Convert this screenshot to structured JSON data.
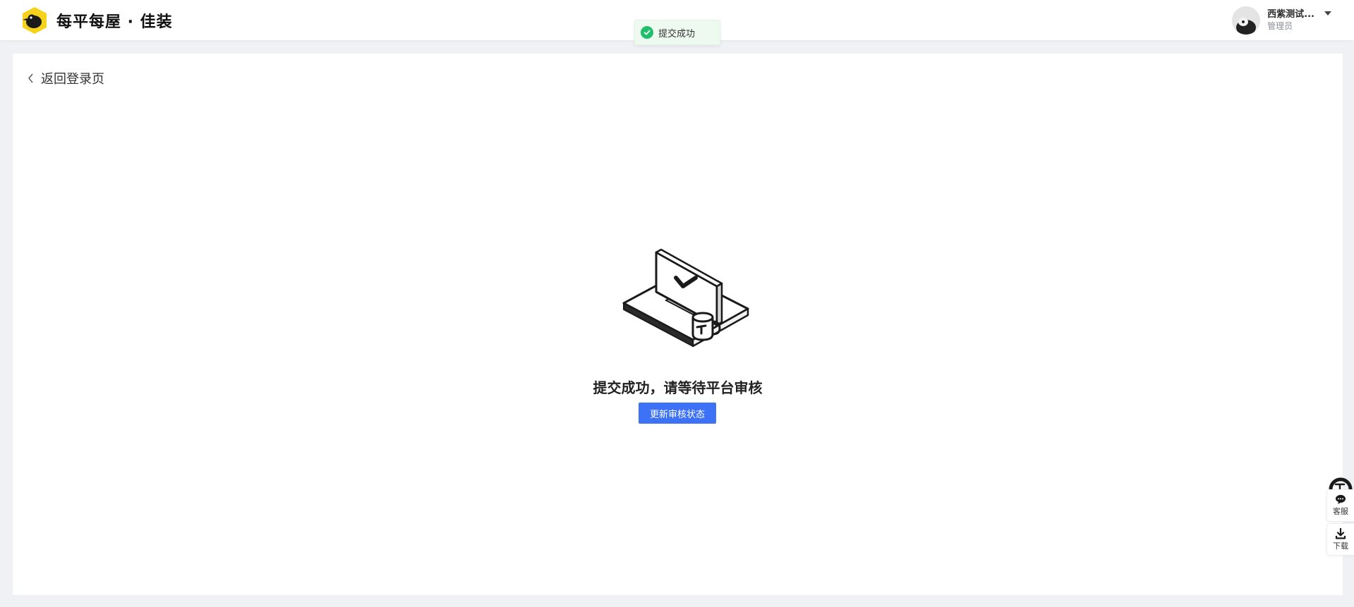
{
  "header": {
    "brand": "每平每屋 · 佳装",
    "user_name": "西紫测试...",
    "user_role": "管理员"
  },
  "toast": {
    "message": "提交成功",
    "color": "#1fbf6b"
  },
  "page": {
    "back_label": "返回登录页",
    "result_title": "提交成功，请等待平台审核",
    "refresh_button": "更新审核状态"
  },
  "float_tools": {
    "service_label": "客服",
    "download_label": "下载"
  },
  "colors": {
    "primary": "#3d72f6",
    "logo": "#f7d21b",
    "success": "#1fbf6b"
  }
}
